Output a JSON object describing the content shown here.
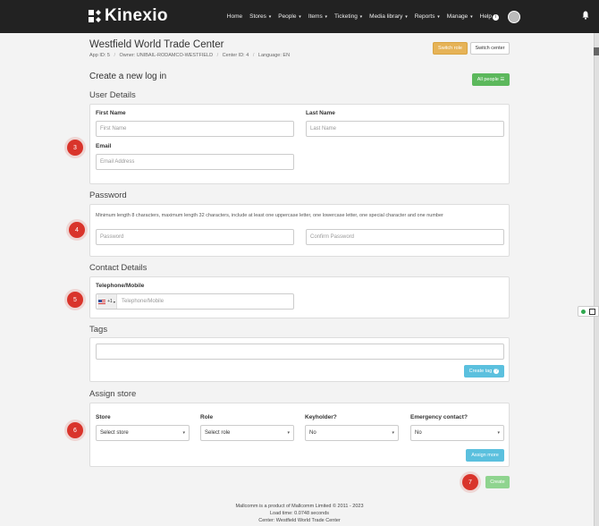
{
  "nav": {
    "brand": "Kinexio",
    "items": [
      {
        "label": "Home",
        "caret": false
      },
      {
        "label": "Stores",
        "caret": true
      },
      {
        "label": "People",
        "caret": true
      },
      {
        "label": "Items",
        "caret": true
      },
      {
        "label": "Ticketing",
        "caret": true
      },
      {
        "label": "Media library",
        "caret": true
      },
      {
        "label": "Reports",
        "caret": true
      },
      {
        "label": "Manage",
        "caret": true
      }
    ],
    "help": "Help",
    "help_badge": "i",
    "caret": "▾"
  },
  "header": {
    "title": "Westfield World Trade Center",
    "app_id": "App ID: 5",
    "owner": "Owner: UNIBAIL-RODAMCO-WESTFIELD",
    "center_id": "Center ID: 4",
    "language": "Language: EN",
    "separator": "/",
    "switch_role": "Switch role",
    "switch_center": "Switch center"
  },
  "page": {
    "title": "Create a new log in",
    "all_people": "All people ☰"
  },
  "user_details": {
    "section": "User Details",
    "first_name_label": "First Name",
    "first_name_placeholder": "First Name",
    "last_name_label": "Last Name",
    "last_name_placeholder": "Last Name",
    "email_label": "Email",
    "email_placeholder": "Email Address"
  },
  "password": {
    "section": "Password",
    "help": "Minimum length 8 characters, maximum length 32 characters, include at least one uppercase letter, one lowercase letter, one special character and one number",
    "password_placeholder": "Password",
    "confirm_placeholder": "Confirm Password"
  },
  "contact": {
    "section": "Contact Details",
    "phone_label": "Telephone/Mobile",
    "dial_code": "+1",
    "phone_placeholder": "Telephone/Mobile"
  },
  "tags": {
    "section": "Tags",
    "create_tag": "Create tag"
  },
  "assign_store": {
    "section": "Assign store",
    "store_label": "Store",
    "store_value": "Select store",
    "role_label": "Role",
    "role_value": "Select role",
    "keyholder_label": "Keyholder?",
    "keyholder_value": "No",
    "emergency_label": "Emergency contact?",
    "emergency_value": "No",
    "assign_more": "Assign more"
  },
  "steps": [
    "3",
    "4",
    "5",
    "6",
    "7"
  ],
  "create_button": "Create",
  "footer": {
    "line1": "Mallcomm is a product of Mallcomm Limited © 2011 - 2023",
    "line2": "Load time: 0.0748 seconds",
    "line3": "Center: Westfield World Trade Center"
  },
  "colors": {
    "nav_bg": "#222222",
    "switch_role": "#e6b357",
    "success": "#5cb85c",
    "info": "#5bc0de",
    "step_badge": "#d9342b"
  }
}
